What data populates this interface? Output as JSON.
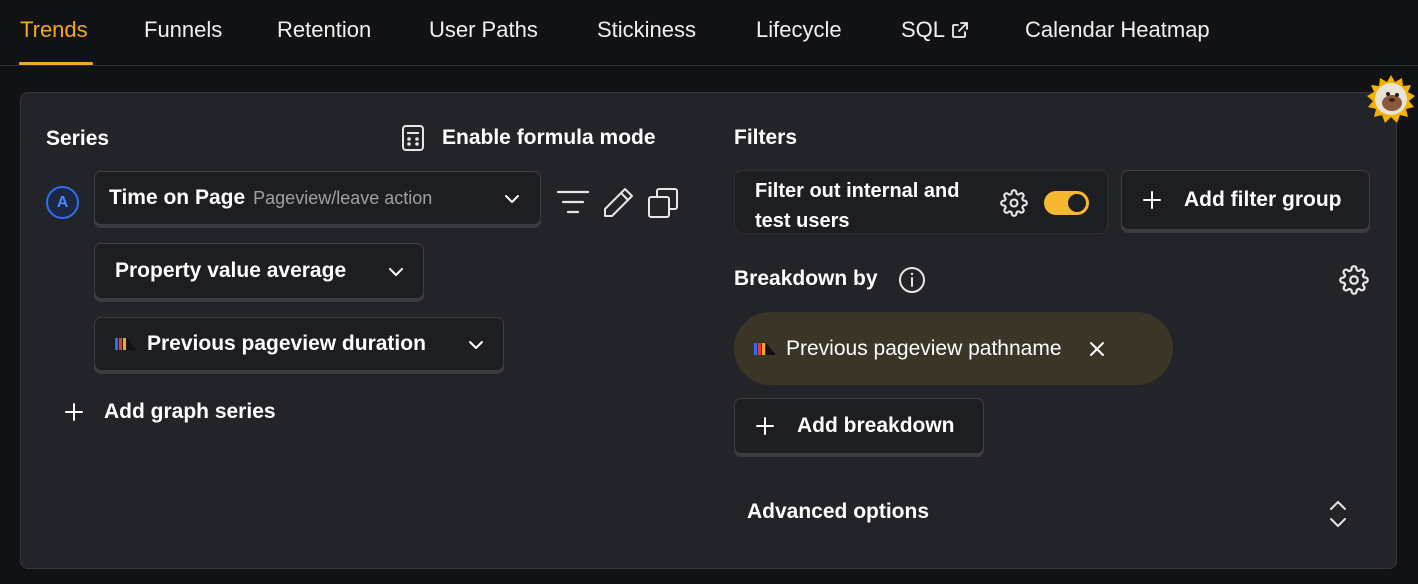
{
  "tabs": {
    "items": [
      {
        "label": "Trends"
      },
      {
        "label": "Funnels"
      },
      {
        "label": "Retention"
      },
      {
        "label": "User Paths"
      },
      {
        "label": "Stickiness"
      },
      {
        "label": "Lifecycle"
      },
      {
        "label": "SQL"
      },
      {
        "label": "Calendar Heatmap"
      }
    ],
    "active_color": "#f5a623"
  },
  "series": {
    "title": "Series",
    "formula_label": "Enable formula mode",
    "badge": "A",
    "event_name": "Time on Page",
    "event_subtitle": "Pageview/leave action",
    "aggregation": "Property value average",
    "property": "Previous pageview duration",
    "add_label": "Add graph series"
  },
  "filters": {
    "title": "Filters",
    "internal_filter_label": "Filter out internal and test users",
    "internal_filter_enabled": true,
    "add_group_label": "Add filter group"
  },
  "breakdown": {
    "title": "Breakdown by",
    "chip_label": "Previous pageview pathname",
    "add_label": "Add breakdown"
  },
  "advanced": {
    "label": "Advanced options"
  },
  "colors": {
    "accent": "#f5a623",
    "toggle_on": "#f7b731",
    "badge_blue": "#2f6ef0",
    "panel_bg": "#232429",
    "chip_bg": "#3a3526"
  }
}
